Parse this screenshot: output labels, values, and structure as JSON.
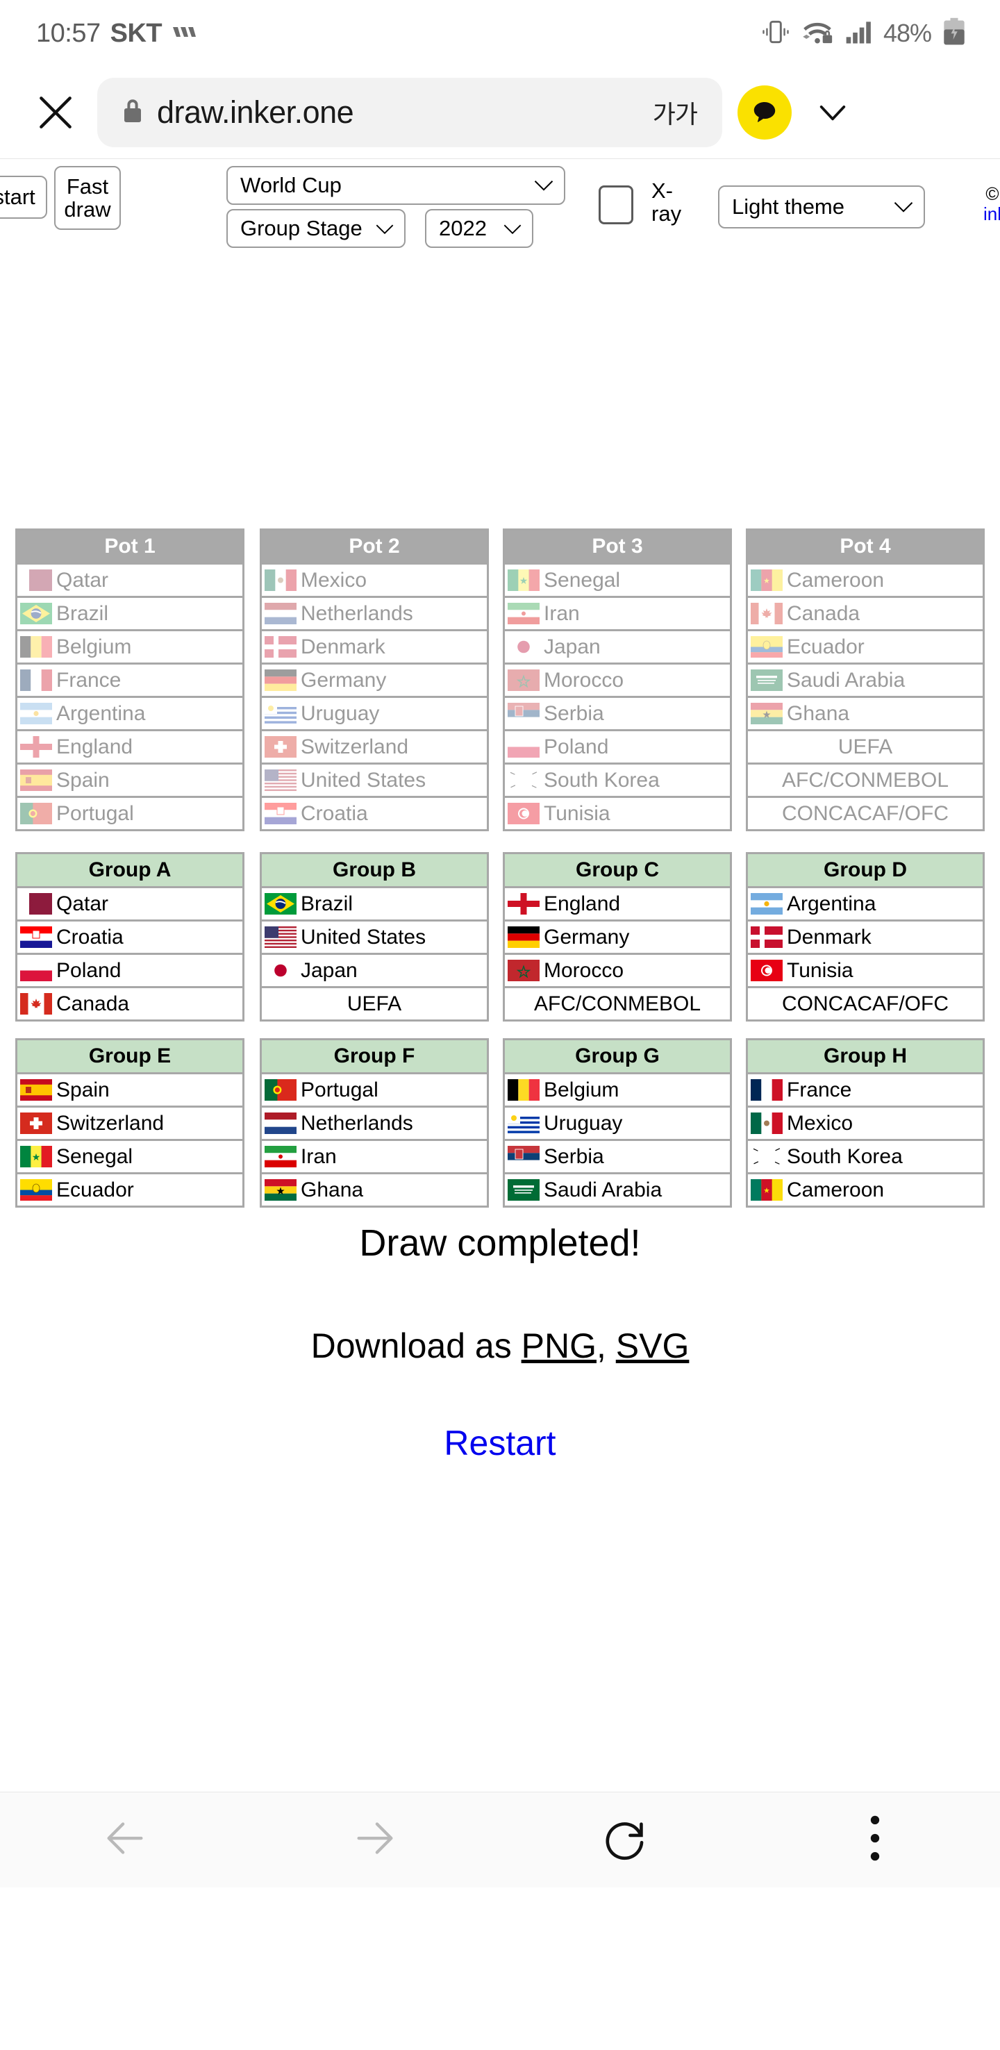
{
  "status_bar": {
    "time": "10:57",
    "carrier": "SKT",
    "battery_percent": "48%",
    "icons": [
      "vibrate-icon",
      "wifi-lock-icon",
      "signal-bars-icon",
      "battery-icon"
    ]
  },
  "browser": {
    "close_label": "close-icon",
    "url": "draw.inker.one",
    "font_size_label": "가가",
    "secure": true
  },
  "controls": {
    "restart_button": "estart",
    "fast_draw_button": "Fast\ndraw",
    "fast_draw_line1": "Fast",
    "fast_draw_line2": "draw",
    "competition_select": "World Cup",
    "stage_select": "Group Stage",
    "year_select": "2022",
    "xray_label_line1": "X-",
    "xray_label_line2": "ray",
    "xray_checked": false,
    "theme_select": "Light theme",
    "copyright_symbol": "©",
    "copyright_link": "inl"
  },
  "pots": [
    {
      "title": "Pot 1",
      "teams": [
        {
          "name": "Qatar",
          "flag": "qa"
        },
        {
          "name": "Brazil",
          "flag": "br"
        },
        {
          "name": "Belgium",
          "flag": "be"
        },
        {
          "name": "France",
          "flag": "fr"
        },
        {
          "name": "Argentina",
          "flag": "ar"
        },
        {
          "name": "England",
          "flag": "en"
        },
        {
          "name": "Spain",
          "flag": "es"
        },
        {
          "name": "Portugal",
          "flag": "pt"
        }
      ]
    },
    {
      "title": "Pot 2",
      "teams": [
        {
          "name": "Mexico",
          "flag": "mx"
        },
        {
          "name": "Netherlands",
          "flag": "nl"
        },
        {
          "name": "Denmark",
          "flag": "dk"
        },
        {
          "name": "Germany",
          "flag": "de"
        },
        {
          "name": "Uruguay",
          "flag": "uy"
        },
        {
          "name": "Switzerland",
          "flag": "ch"
        },
        {
          "name": "United States",
          "flag": "us"
        },
        {
          "name": "Croatia",
          "flag": "hr"
        }
      ]
    },
    {
      "title": "Pot 3",
      "teams": [
        {
          "name": "Senegal",
          "flag": "sn"
        },
        {
          "name": "Iran",
          "flag": "ir"
        },
        {
          "name": "Japan",
          "flag": "jp"
        },
        {
          "name": "Morocco",
          "flag": "ma"
        },
        {
          "name": "Serbia",
          "flag": "rs"
        },
        {
          "name": "Poland",
          "flag": "pl"
        },
        {
          "name": "South Korea",
          "flag": "kr"
        },
        {
          "name": "Tunisia",
          "flag": "tn"
        }
      ]
    },
    {
      "title": "Pot 4",
      "teams": [
        {
          "name": "Cameroon",
          "flag": "cm"
        },
        {
          "name": "Canada",
          "flag": "ca"
        },
        {
          "name": "Ecuador",
          "flag": "ec"
        },
        {
          "name": "Saudi Arabia",
          "flag": "sa"
        },
        {
          "name": "Ghana",
          "flag": "gh"
        },
        {
          "name": "UEFA",
          "flag": ""
        },
        {
          "name": "AFC/CONMEBOL",
          "flag": ""
        },
        {
          "name": "CONCACAF/OFC",
          "flag": ""
        }
      ]
    }
  ],
  "groups": [
    {
      "title": "Group A",
      "teams": [
        {
          "name": "Qatar",
          "flag": "qa"
        },
        {
          "name": "Croatia",
          "flag": "hr"
        },
        {
          "name": "Poland",
          "flag": "pl"
        },
        {
          "name": "Canada",
          "flag": "ca"
        }
      ]
    },
    {
      "title": "Group B",
      "teams": [
        {
          "name": "Brazil",
          "flag": "br"
        },
        {
          "name": "United States",
          "flag": "us"
        },
        {
          "name": "Japan",
          "flag": "jp"
        },
        {
          "name": "UEFA",
          "flag": ""
        }
      ]
    },
    {
      "title": "Group C",
      "teams": [
        {
          "name": "England",
          "flag": "en"
        },
        {
          "name": "Germany",
          "flag": "de"
        },
        {
          "name": "Morocco",
          "flag": "ma"
        },
        {
          "name": "AFC/CONMEBOL",
          "flag": ""
        }
      ]
    },
    {
      "title": "Group D",
      "teams": [
        {
          "name": "Argentina",
          "flag": "ar"
        },
        {
          "name": "Denmark",
          "flag": "dk"
        },
        {
          "name": "Tunisia",
          "flag": "tn"
        },
        {
          "name": "CONCACAF/OFC",
          "flag": ""
        }
      ]
    },
    {
      "title": "Group E",
      "teams": [
        {
          "name": "Spain",
          "flag": "es"
        },
        {
          "name": "Switzerland",
          "flag": "ch"
        },
        {
          "name": "Senegal",
          "flag": "sn"
        },
        {
          "name": "Ecuador",
          "flag": "ec"
        }
      ]
    },
    {
      "title": "Group F",
      "teams": [
        {
          "name": "Portugal",
          "flag": "pt"
        },
        {
          "name": "Netherlands",
          "flag": "nl"
        },
        {
          "name": "Iran",
          "flag": "ir"
        },
        {
          "name": "Ghana",
          "flag": "gh"
        }
      ]
    },
    {
      "title": "Group G",
      "teams": [
        {
          "name": "Belgium",
          "flag": "be"
        },
        {
          "name": "Uruguay",
          "flag": "uy"
        },
        {
          "name": "Serbia",
          "flag": "rs"
        },
        {
          "name": "Saudi Arabia",
          "flag": "sa"
        }
      ]
    },
    {
      "title": "Group H",
      "teams": [
        {
          "name": "France",
          "flag": "fr"
        },
        {
          "name": "Mexico",
          "flag": "mx"
        },
        {
          "name": "South Korea",
          "flag": "kr"
        },
        {
          "name": "Cameroon",
          "flag": "cm"
        }
      ]
    }
  ],
  "completion": {
    "title": "Draw completed!",
    "download_prefix": "Download as ",
    "download_png": "PNG",
    "download_sep": ", ",
    "download_svg": "SVG",
    "restart": "Restart"
  },
  "nav_bar": {
    "back": "back-arrow-icon",
    "forward": "forward-arrow-icon",
    "reload": "reload-icon",
    "menu": "overflow-menu-icon"
  },
  "colors": {
    "pot_header_bg": "#a9a9a9",
    "group_header_bg": "#c6e0c6",
    "link": "#0000ee",
    "kakao_yellow": "#fae100",
    "border": "#a8a8a8"
  }
}
